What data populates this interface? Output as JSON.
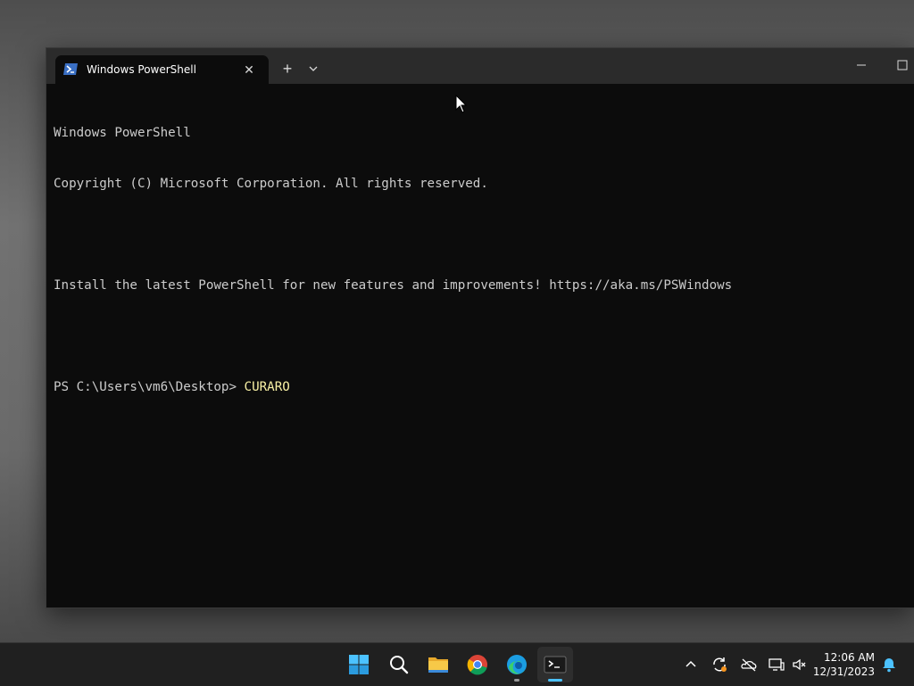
{
  "window": {
    "tab_title": "Windows PowerShell",
    "tab_icon": "powershell-icon",
    "new_tab_icon": "plus-icon",
    "dropdown_icon": "chevron-down-icon",
    "minimize_icon": "minimize-icon",
    "maximize_icon": "maximize-icon"
  },
  "terminal": {
    "lines": [
      "Windows PowerShell",
      "Copyright (C) Microsoft Corporation. All rights reserved.",
      "",
      "Install the latest PowerShell for new features and improvements! https://aka.ms/PSWindows",
      ""
    ],
    "prompt": "PS C:\\Users\\vm6\\Desktop> ",
    "command": "CURARO",
    "text_color": "#cccccc",
    "command_color": "#f9f1a5",
    "background": "#0c0c0c"
  },
  "taskbar": {
    "pinned": [
      {
        "name": "start-icon"
      },
      {
        "name": "search-icon"
      },
      {
        "name": "file-explorer-icon"
      },
      {
        "name": "chrome-icon"
      },
      {
        "name": "edge-icon"
      },
      {
        "name": "terminal-icon",
        "active": true
      }
    ],
    "tray": [
      "chevron-up-icon",
      "sync-icon",
      "onedrive-icon",
      "network-icon",
      "volume-muted-icon"
    ],
    "time": "12:06 AM",
    "date": "12/31/2023",
    "notification_icon": "bell-icon",
    "accent": "#4cc2ff"
  }
}
